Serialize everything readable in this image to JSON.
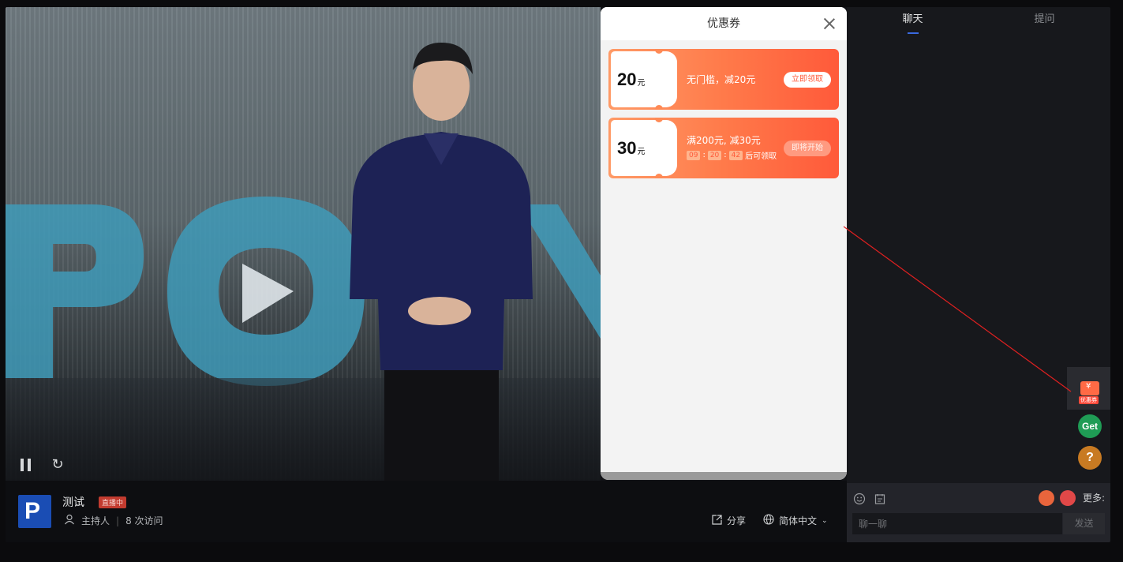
{
  "popup": {
    "title": "优惠券",
    "coupons": [
      {
        "amount": "20",
        "unit": "元",
        "desc": "无门槛，减20元",
        "button": "立即领取"
      },
      {
        "amount": "30",
        "unit": "元",
        "desc": "满200元, 减30元",
        "button": "即将开始",
        "timer": {
          "h": "09",
          "m": "20",
          "s": "42",
          "suffix": "后可领取"
        }
      }
    ]
  },
  "room": {
    "title": "测试",
    "badge": "直播中",
    "host": "主持人",
    "visits": "8 次访问",
    "share": "分享",
    "language": "简体中文"
  },
  "chat": {
    "tabs": [
      "聊天",
      "提问"
    ],
    "coupon_tool_label": "优惠券",
    "get_label": "Get",
    "question_label": "?",
    "more": "更多",
    "input_placeholder": "聊一聊",
    "send": "发送"
  },
  "colors": {
    "coupon_gradient_start": "#ff9a66",
    "coupon_gradient_end": "#ff5a3a",
    "live_badge": "#c23b2f",
    "get_green": "#1f9c55",
    "question_orange": "#c87a22",
    "annotation_red": "#e02020"
  }
}
